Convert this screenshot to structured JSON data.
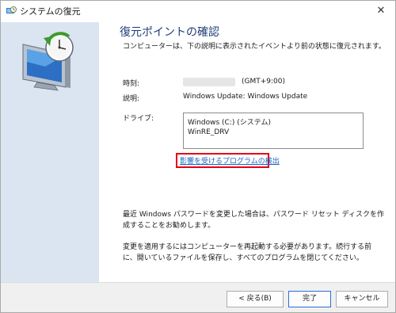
{
  "window": {
    "title": "システムの復元",
    "close_glyph": "✕"
  },
  "page": {
    "heading": "復元ポイントの確認",
    "description": "コンピューターは、下の説明に表示されたイベントより前の状態に復元されます。"
  },
  "details": {
    "time_label": "時刻:",
    "time_zone": "(GMT+9:00)",
    "description_label": "説明:",
    "description_value": "Windows Update: Windows Update",
    "drives_label": "ドライブ:",
    "drives": [
      "Windows (C:) (システム)",
      "WinRE_DRV"
    ]
  },
  "scan_link": "影響を受けるプログラムの検出",
  "notes": {
    "password": "最近 Windows パスワードを変更した場合は、パスワード リセット ディスクを作成することをお勧めします。",
    "restart": "変更を適用するにはコンピューターを再起動する必要があります。続行する前に、開いているファイルを保存し、すべてのプログラムを閉じてください。"
  },
  "buttons": {
    "back": "< 戻る(B)",
    "finish": "完了",
    "cancel": "キャンセル"
  },
  "icons": {
    "app": "system-restore-icon",
    "hero": "monitor-clock-restore-icon",
    "close": "close-icon"
  },
  "colors": {
    "sidebar": "#dbe4f1",
    "heading": "#1f3d7a",
    "link": "#1a63c4",
    "highlight": "#e60012"
  }
}
